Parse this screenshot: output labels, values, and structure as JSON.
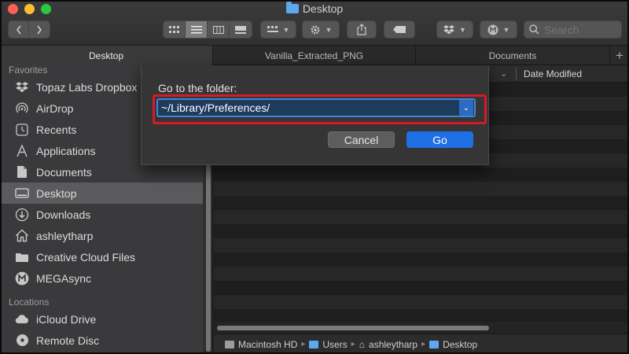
{
  "window": {
    "title": "Desktop"
  },
  "toolbar": {
    "search_placeholder": "Search",
    "icons": [
      "back-icon",
      "forward-icon",
      "icon-view-icon",
      "list-view-icon",
      "column-view-icon",
      "gallery-view-icon",
      "group-icon",
      "gear-icon",
      "share-icon",
      "tag-icon",
      "dropbox-icon",
      "mega-icon",
      "search-icon"
    ]
  },
  "tabs": [
    {
      "label": "Desktop",
      "active": true
    },
    {
      "label": "Vanilla_Extracted_PNG",
      "active": false
    },
    {
      "label": "Documents",
      "active": false
    }
  ],
  "sidebar": {
    "favorites_label": "Favorites",
    "favorites": [
      {
        "label": "Topaz Labs Dropbox",
        "icon": "dropbox-icon"
      },
      {
        "label": "AirDrop",
        "icon": "airdrop-icon"
      },
      {
        "label": "Recents",
        "icon": "clock-icon"
      },
      {
        "label": "Applications",
        "icon": "applications-icon"
      },
      {
        "label": "Documents",
        "icon": "document-icon"
      },
      {
        "label": "Desktop",
        "icon": "desktop-icon",
        "selected": true
      },
      {
        "label": "Downloads",
        "icon": "download-icon"
      },
      {
        "label": "ashleytharp",
        "icon": "home-icon"
      },
      {
        "label": "Creative Cloud Files",
        "icon": "folder-icon"
      },
      {
        "label": "MEGAsync",
        "icon": "mega-icon"
      }
    ],
    "locations_label": "Locations",
    "locations": [
      {
        "label": "iCloud Drive",
        "icon": "cloud-icon"
      },
      {
        "label": "Remote Disc",
        "icon": "disc-icon"
      }
    ]
  },
  "file_list": {
    "date_column": "Date Modified"
  },
  "dialog": {
    "title": "Go to the folder:",
    "path_value": "~/Library/Preferences/",
    "cancel_label": "Cancel",
    "go_label": "Go"
  },
  "pathbar": {
    "items": [
      "Macintosh HD",
      "Users",
      "ashleytharp",
      "Desktop"
    ]
  },
  "colors": {
    "accent": "#1f6fe5",
    "highlight_box": "#d7192a",
    "folder": "#5ea8f0"
  }
}
